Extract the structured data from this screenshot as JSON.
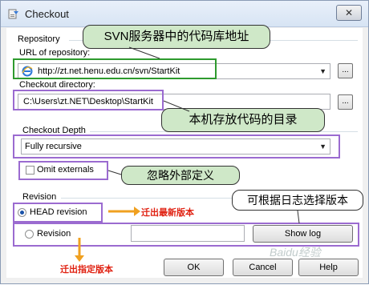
{
  "window": {
    "title": "Checkout",
    "close_glyph": "✕",
    "icon": "checkout-icon"
  },
  "repository": {
    "group_label": "Repository",
    "url_label": "URL of repository:",
    "url_value": "http://zt.net.henu.edu.cn/svn/StartKit",
    "browse_label": "...",
    "dir_label": "Checkout directory:",
    "dir_value": "C:\\Users\\zt.NET\\Desktop\\StartKit",
    "dir_browse_label": "..."
  },
  "depth": {
    "group_label": "Checkout Depth",
    "selected": "Fully recursive",
    "omit_externals_label": "Omit externals",
    "omit_externals_checked": false
  },
  "revision": {
    "group_label": "Revision",
    "head_label": "HEAD revision",
    "head_selected": true,
    "specific_label": "Revision",
    "revision_value": "",
    "show_log_label": "Show log"
  },
  "buttons": {
    "ok": "OK",
    "cancel": "Cancel",
    "help": "Help"
  },
  "annotations": {
    "svn_server": "SVN服务器中的代码库地址",
    "local_dir": "本机存放代码的目录",
    "ignore_externals": "忽略外部定义",
    "log_select": "可根据日志选择版本",
    "checkout_latest": "迁出最新版本",
    "checkout_specific": "迁出指定版本"
  },
  "watermark": "Baidu经验",
  "colors": {
    "callout_fill": "#cfe8c8",
    "highlight_green": "#2e9a2e",
    "highlight_purple": "#9b6bd0",
    "annotation_red": "#e02010",
    "arrow_orange": "#f0a020"
  }
}
